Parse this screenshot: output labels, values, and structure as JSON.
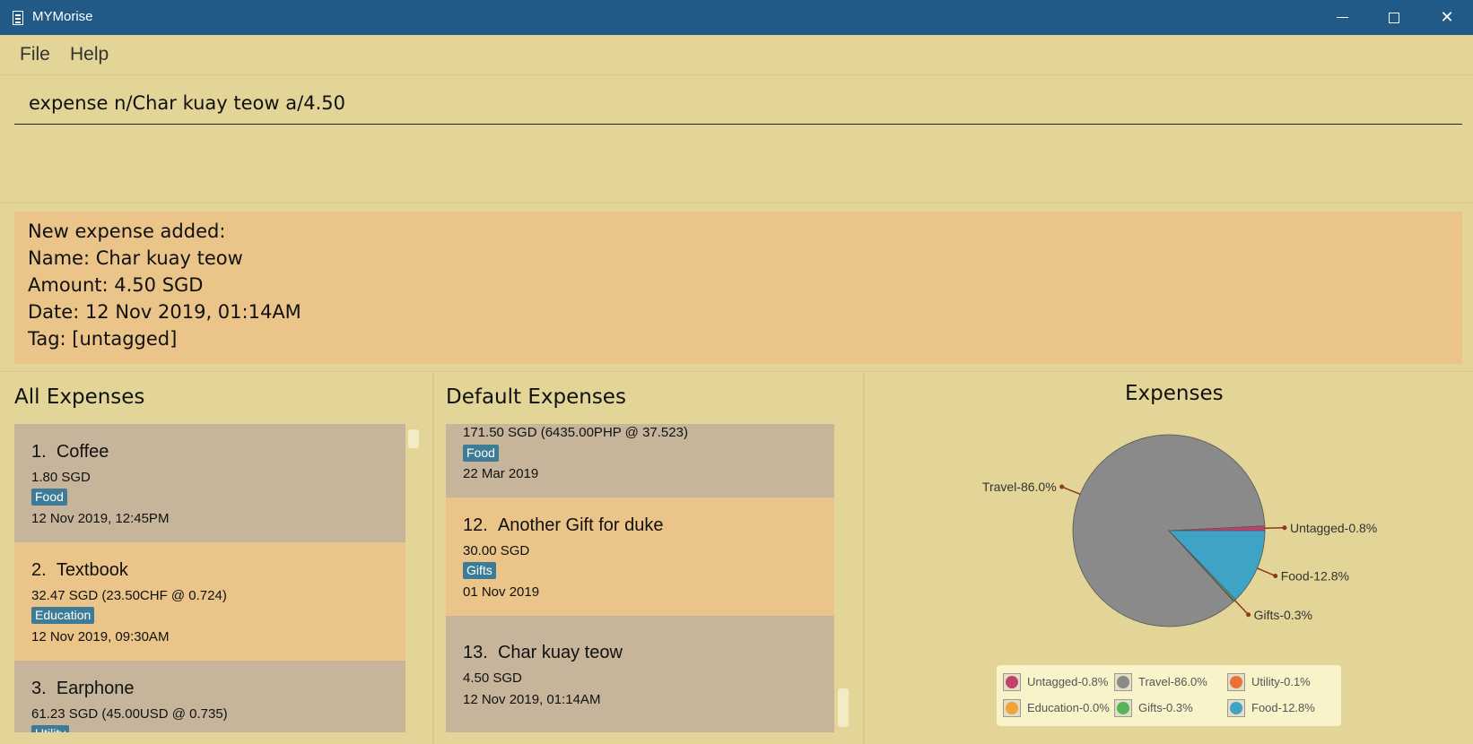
{
  "window": {
    "title": "MYMorise",
    "icon": "calculator-icon"
  },
  "menu": {
    "file": "File",
    "help": "Help"
  },
  "command": {
    "value": "expense n/Char kuay teow a/4.50"
  },
  "result": {
    "lines": [
      "New expense added:",
      "Name: Char kuay teow",
      "Amount: 4.50 SGD",
      "Date: 12 Nov 2019, 01:14AM",
      "Tag: [untagged]"
    ]
  },
  "all_expenses": {
    "title": "All Expenses",
    "items": [
      {
        "index": "1.",
        "name": "Coffee",
        "amount": "1.80 SGD",
        "tag": "Food",
        "date": "12 Nov 2019, 12:45PM"
      },
      {
        "index": "2.",
        "name": "Textbook",
        "amount": "32.47 SGD  (23.50CHF @ 0.724)",
        "tag": "Education",
        "date": "12 Nov 2019, 09:30AM"
      },
      {
        "index": "3.",
        "name": "Earphone",
        "amount": "61.23 SGD  (45.00USD @ 0.735)",
        "tag": "Utility",
        "date": ""
      }
    ]
  },
  "default_expenses": {
    "title": "Default Expenses",
    "items": [
      {
        "index": "",
        "name": "",
        "amount": "171.50 SGD  (6435.00PHP @ 37.523)",
        "tag": "Food",
        "date": "22 Mar 2019"
      },
      {
        "index": "12.",
        "name": "Another Gift for duke",
        "amount": "30.00 SGD",
        "tag": "Gifts",
        "date": "01 Nov 2019"
      },
      {
        "index": "13.",
        "name": "Char kuay teow",
        "amount": "4.50 SGD",
        "tag": "",
        "date": "12 Nov 2019, 01:14AM"
      }
    ]
  },
  "chart_data": {
    "type": "pie",
    "title": "Expenses",
    "slices": [
      {
        "label": "Untagged-0.8%",
        "value": 0.8,
        "color": "#c2416b"
      },
      {
        "label": "Travel-86.0%",
        "value": 86.0,
        "color": "#8a8a8a"
      },
      {
        "label": "Utility-0.1%",
        "value": 0.1,
        "color": "#e8713a"
      },
      {
        "label": "Education-0.0%",
        "value": 0.0,
        "color": "#f2a23a"
      },
      {
        "label": "Gifts-0.3%",
        "value": 0.3,
        "color": "#5ab25c"
      },
      {
        "label": "Food-12.8%",
        "value": 12.8,
        "color": "#3fa3c6"
      }
    ],
    "legend": [
      "Untagged-0.8%",
      "Travel-86.0%",
      "Utility-0.1%",
      "Education-0.0%",
      "Gifts-0.3%",
      "Food-12.8%"
    ],
    "legend_position": "bottom"
  }
}
